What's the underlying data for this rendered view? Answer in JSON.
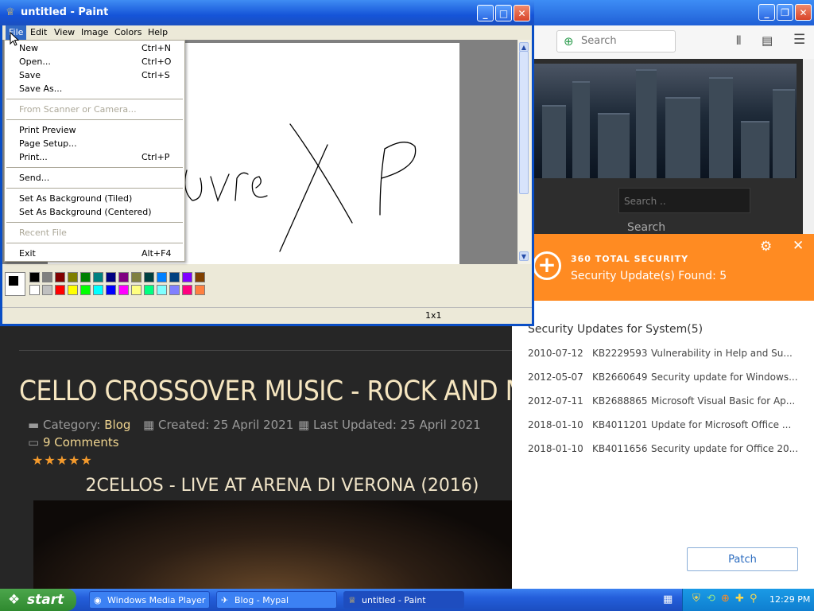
{
  "browser": {
    "search_placeholder": "Search",
    "web_search_placeholder": "Search ..",
    "web_search_button": "Search"
  },
  "security": {
    "brand": "360 TOTAL SECURITY",
    "found": "Security Update(s) Found: 5",
    "list_title": "Security Updates for System(5)",
    "updates": [
      {
        "date": "2010-07-12",
        "kb": "KB2229593",
        "desc": "Vulnerability in Help and Su..."
      },
      {
        "date": "2012-05-07",
        "kb": "KB2660649",
        "desc": "Security update for Windows..."
      },
      {
        "date": "2012-07-11",
        "kb": "KB2688865",
        "desc": "Microsoft Visual Basic for Ap..."
      },
      {
        "date": "2018-01-10",
        "kb": "KB4011201",
        "desc": "Update for Microsoft Office ..."
      },
      {
        "date": "2018-01-10",
        "kb": "KB4011656",
        "desc": "Security update for Office 20..."
      }
    ],
    "patch_label": "Patch",
    "accent": "#ff8b22"
  },
  "article": {
    "title": "CELLO CROSSOVER MUSIC - ROCK AND METAL",
    "category_label": "Category:",
    "category_value": "Blog",
    "created": "Created: 25 April 2021",
    "updated": "Last Updated: 25 April 2021",
    "comments": "9 Comments",
    "stars": "★★★★★",
    "video_title": "2CELLOS - LIVE AT ARENA DI VERONA (2016)"
  },
  "paint": {
    "title": "untitled - Paint",
    "menus": [
      "File",
      "Edit",
      "View",
      "Image",
      "Colors",
      "Help"
    ],
    "status_size": "1x1",
    "drawing_text": "ove XP"
  },
  "file_menu": {
    "new": "New",
    "new_sc": "Ctrl+N",
    "open": "Open...",
    "open_sc": "Ctrl+O",
    "save": "Save",
    "save_sc": "Ctrl+S",
    "save_as": "Save As...",
    "scanner": "From Scanner or Camera...",
    "print_preview": "Print Preview",
    "page_setup": "Page Setup...",
    "print": "Print...",
    "print_sc": "Ctrl+P",
    "send": "Send...",
    "bg_tiled": "Set As Background (Tiled)",
    "bg_centered": "Set As Background (Centered)",
    "recent": "Recent File",
    "exit": "Exit",
    "exit_sc": "Alt+F4"
  },
  "taskbar": {
    "start": "start",
    "tasks": [
      "Windows Media Player",
      "Blog - Mypal",
      "untitled - Paint"
    ],
    "clock": "12:29 PM"
  }
}
